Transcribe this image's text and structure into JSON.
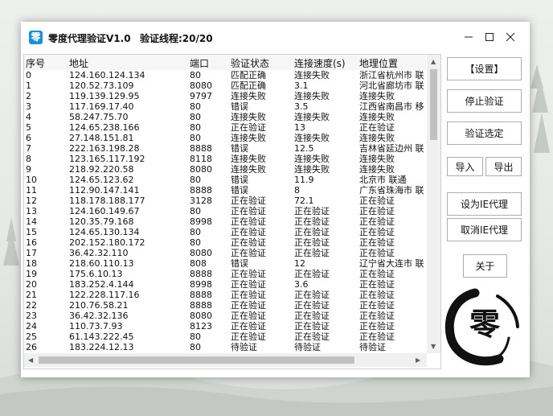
{
  "window": {
    "title": "零度代理验证V1.0",
    "progress_label": "验证线程:20/20",
    "app_icon_glyph": "零"
  },
  "table": {
    "columns": [
      "序号",
      "地址",
      "端口",
      "验证状态",
      "连接速度(s)",
      "地理位置"
    ],
    "rows": [
      [
        "0",
        "124.160.124.134",
        "80",
        "匹配正确",
        "连接失败",
        "浙江省杭州市 联"
      ],
      [
        "1",
        "120.52.73.109",
        "8080",
        "匹配正确",
        "3.1",
        "河北省廊坊市 联"
      ],
      [
        "2",
        "119.139.129.95",
        "9797",
        "连接失败",
        "连接失败",
        "连接失败"
      ],
      [
        "3",
        "117.169.17.40",
        "80",
        "错误",
        "3.5",
        "江西省南昌市 移"
      ],
      [
        "4",
        "58.247.75.70",
        "80",
        "连接失败",
        "连接失败",
        "连接失败"
      ],
      [
        "5",
        "124.65.238.166",
        "80",
        "正在验证",
        "13",
        "正在验证"
      ],
      [
        "6",
        "27.148.151.81",
        "80",
        "连接失败",
        "连接失败",
        "连接失败"
      ],
      [
        "7",
        "222.163.198.28",
        "8888",
        "错误",
        "12.5",
        "吉林省延边州 联"
      ],
      [
        "8",
        "123.165.117.192",
        "8118",
        "连接失败",
        "连接失败",
        "连接失败"
      ],
      [
        "9",
        "218.92.220.58",
        "8080",
        "连接失败",
        "连接失败",
        "连接失败"
      ],
      [
        "10",
        "124.65.123.62",
        "80",
        "错误",
        "11.9",
        "北京市 联通"
      ],
      [
        "11",
        "112.90.147.141",
        "8888",
        "错误",
        "8",
        "广东省珠海市 联"
      ],
      [
        "12",
        "118.178.188.177",
        "3128",
        "正在验证",
        "72.1",
        "正在验证"
      ],
      [
        "13",
        "124.160.149.67",
        "80",
        "正在验证",
        "正在验证",
        "正在验证"
      ],
      [
        "14",
        "120.35.79.168",
        "8998",
        "正在验证",
        "正在验证",
        "正在验证"
      ],
      [
        "15",
        "124.65.130.134",
        "80",
        "正在验证",
        "正在验证",
        "正在验证"
      ],
      [
        "16",
        "202.152.180.172",
        "80",
        "正在验证",
        "正在验证",
        "正在验证"
      ],
      [
        "17",
        "36.42.32.110",
        "8080",
        "正在验证",
        "正在验证",
        "正在验证"
      ],
      [
        "18",
        "218.60.110.13",
        "808",
        "错误",
        "12",
        "辽宁省大连市 联"
      ],
      [
        "19",
        "175.6.10.13",
        "8888",
        "正在验证",
        "正在验证",
        "正在验证"
      ],
      [
        "20",
        "183.252.4.144",
        "8998",
        "正在验证",
        "3.6",
        "正在验证"
      ],
      [
        "21",
        "122.228.117.16",
        "8888",
        "正在验证",
        "正在验证",
        "正在验证"
      ],
      [
        "22",
        "210.76.58.21",
        "8888",
        "正在验证",
        "正在验证",
        "正在验证"
      ],
      [
        "23",
        "36.42.32.136",
        "8080",
        "正在验证",
        "正在验证",
        "正在验证"
      ],
      [
        "24",
        "110.73.7.93",
        "8123",
        "正在验证",
        "正在验证",
        "正在验证"
      ],
      [
        "25",
        "61.143.222.45",
        "80",
        "正在验证",
        "正在验证",
        "正在验证"
      ],
      [
        "26",
        "183.224.12.13",
        "80",
        "待验证",
        "待验证",
        "待验证"
      ]
    ]
  },
  "buttons": {
    "settings": "【设置】",
    "stop": "停止验证",
    "verify_selected": "验证选定",
    "import": "导入",
    "export": "导出",
    "set_ie_proxy": "设为IE代理",
    "cancel_ie_proxy": "取消IE代理",
    "about": "关于"
  },
  "logo": {
    "glyph": "零"
  },
  "colors": {
    "accent": "#1d8ee0",
    "logo_ink": "#111111"
  }
}
